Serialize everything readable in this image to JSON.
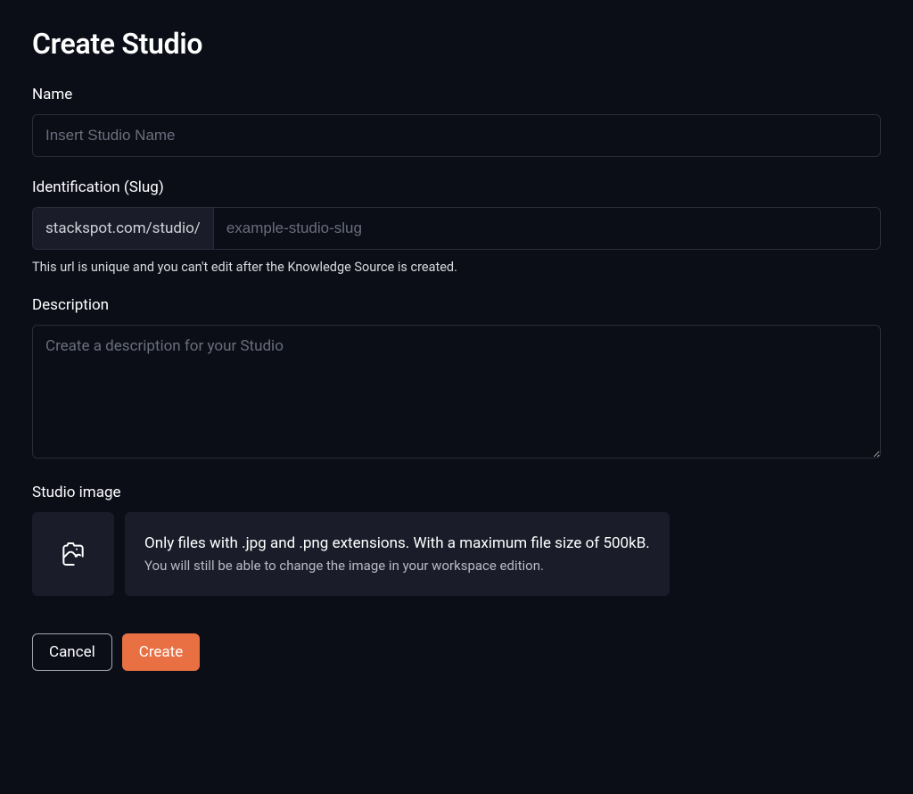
{
  "page": {
    "title": "Create Studio"
  },
  "form": {
    "name": {
      "label": "Name",
      "value": "",
      "placeholder": "Insert Studio Name"
    },
    "slug": {
      "label": "Identification (Slug)",
      "prefix": "stackspot.com/studio/",
      "value": "",
      "placeholder": "example-studio-slug",
      "helpText": "This url is unique and you can't edit after the Knowledge Source is created."
    },
    "description": {
      "label": "Description",
      "value": "",
      "placeholder": "Create a description for your Studio"
    },
    "image": {
      "label": "Studio image",
      "infoPrimary": "Only files with .jpg and .png extensions. With a maximum file size of 500kB.",
      "infoSecondary": "You will still be able to change the image in your workspace edition."
    }
  },
  "actions": {
    "cancel": "Cancel",
    "create": "Create"
  }
}
